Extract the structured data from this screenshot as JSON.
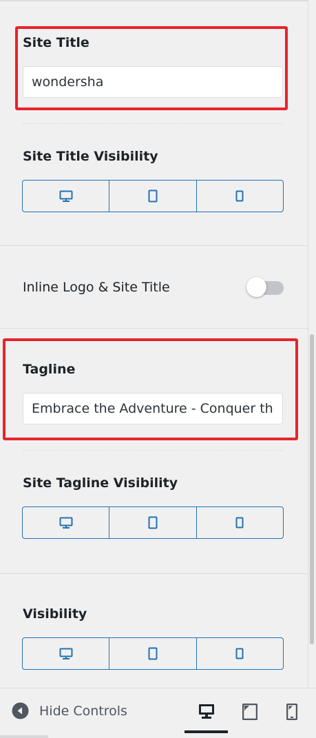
{
  "site_title": {
    "label": "Site Title",
    "value": "wondersha"
  },
  "site_title_visibility": {
    "label": "Site Title Visibility",
    "options": [
      "desktop-icon",
      "tablet-icon",
      "mobile-icon"
    ]
  },
  "inline_logo": {
    "label": "Inline Logo & Site Title",
    "enabled": false
  },
  "tagline": {
    "label": "Tagline",
    "value": "Embrace the Adventure - Conquer the"
  },
  "site_tagline_visibility": {
    "label": "Site Tagline Visibility",
    "options": [
      "desktop-icon",
      "tablet-icon",
      "mobile-icon"
    ]
  },
  "visibility": {
    "label": "Visibility",
    "options": [
      "desktop-icon",
      "tablet-icon",
      "mobile-icon"
    ]
  },
  "footer": {
    "hide_controls_label": "Hide Controls",
    "devices": [
      "desktop-icon",
      "tablet-icon",
      "mobile-icon"
    ],
    "active_device": "desktop"
  },
  "colors": {
    "accent": "#2271b1",
    "highlight": "#e8232b",
    "background": "#f0f0f1"
  }
}
